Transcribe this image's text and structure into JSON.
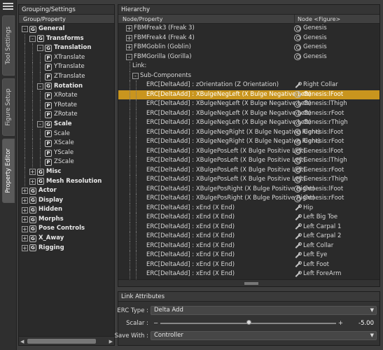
{
  "tabs": {
    "tool_settings": "Tool Settings",
    "figure_setup": "Figure Setup",
    "property_editor": "Property Editor"
  },
  "left_panel": {
    "title": "Grouping/Settings",
    "column": "Group/Property",
    "tree": [
      {
        "level": 0,
        "kind": "group",
        "toggle": "-",
        "label": "General",
        "bold": true
      },
      {
        "level": 1,
        "kind": "group",
        "toggle": "-",
        "label": "Transforms",
        "bold": true
      },
      {
        "level": 2,
        "kind": "group",
        "toggle": "-",
        "label": "Translation",
        "bold": true
      },
      {
        "level": 3,
        "kind": "prop",
        "label": "XTranslate"
      },
      {
        "level": 3,
        "kind": "prop",
        "label": "YTranslate"
      },
      {
        "level": 3,
        "kind": "prop",
        "label": "ZTranslate"
      },
      {
        "level": 2,
        "kind": "group",
        "toggle": "-",
        "label": "Rotation",
        "bold": true
      },
      {
        "level": 3,
        "kind": "prop",
        "label": "XRotate"
      },
      {
        "level": 3,
        "kind": "prop",
        "label": "YRotate"
      },
      {
        "level": 3,
        "kind": "prop",
        "label": "ZRotate"
      },
      {
        "level": 2,
        "kind": "group",
        "toggle": "-",
        "label": "Scale",
        "bold": true
      },
      {
        "level": 3,
        "kind": "prop",
        "label": "Scale"
      },
      {
        "level": 3,
        "kind": "prop",
        "label": "XScale"
      },
      {
        "level": 3,
        "kind": "prop",
        "label": "YScale"
      },
      {
        "level": 3,
        "kind": "prop",
        "label": "ZScale"
      },
      {
        "level": 1,
        "kind": "group",
        "toggle": "+",
        "label": "Misc",
        "bold": true
      },
      {
        "level": 1,
        "kind": "group",
        "toggle": "+",
        "label": "Mesh Resolution",
        "bold": true
      },
      {
        "level": 0,
        "kind": "group",
        "toggle": "+",
        "label": "Actor",
        "bold": true
      },
      {
        "level": 0,
        "kind": "group",
        "toggle": "+",
        "label": "Display",
        "bold": true
      },
      {
        "level": 0,
        "kind": "group",
        "toggle": "+",
        "label": "Hidden",
        "bold": true
      },
      {
        "level": 0,
        "kind": "group",
        "toggle": "+",
        "label": "Morphs",
        "bold": true
      },
      {
        "level": 0,
        "kind": "group",
        "toggle": "+",
        "label": "Pose Controls",
        "bold": true
      },
      {
        "level": 0,
        "kind": "group",
        "toggle": "+",
        "label": "X_Away",
        "bold": true
      },
      {
        "level": 0,
        "kind": "group",
        "toggle": "+",
        "label": "Rigging",
        "bold": true
      }
    ]
  },
  "hierarchy": {
    "title": "Hierarchy",
    "col_property": "Node/Property",
    "col_node": "Node <Figure>",
    "rows": [
      {
        "level": 1,
        "toggle": "+",
        "prop": "FBMFreak3 (Freak 3)",
        "node": "Genesis",
        "icon": "figure"
      },
      {
        "level": 1,
        "toggle": "+",
        "prop": "FBMFreak4 (Freak 4)",
        "node": "Genesis",
        "icon": "figure"
      },
      {
        "level": 1,
        "toggle": "+",
        "prop": "FBMGoblin (Goblin)",
        "node": "Genesis",
        "icon": "figure"
      },
      {
        "level": 1,
        "toggle": "-",
        "prop": "FBMGorilla (Gorilla)",
        "node": "Genesis",
        "icon": "figure"
      },
      {
        "level": 2,
        "toggle": "",
        "prop": "Link:",
        "node": "",
        "icon": ""
      },
      {
        "level": 2,
        "toggle": "-",
        "prop": "Sub-Components",
        "node": "",
        "icon": ""
      },
      {
        "level": 3,
        "toggle": "",
        "prop": "ERC[DeltaAdd] : zOrientation (Z Orientation)",
        "node": "Right Collar",
        "icon": "bone"
      },
      {
        "level": 3,
        "toggle": "",
        "prop": "ERC[DeltaAdd] : XBulgeNegLeft (X Bulge Negative Left)",
        "node": "Genesis:lFoot",
        "icon": "figure",
        "selected": true
      },
      {
        "level": 3,
        "toggle": "",
        "prop": "ERC[DeltaAdd] : XBulgeNegLeft (X Bulge Negative Left)",
        "node": "Genesis:lThigh",
        "icon": "figure"
      },
      {
        "level": 3,
        "toggle": "",
        "prop": "ERC[DeltaAdd] : XBulgeNegLeft (X Bulge Negative Left)",
        "node": "Genesis:rFoot",
        "icon": "figure"
      },
      {
        "level": 3,
        "toggle": "",
        "prop": "ERC[DeltaAdd] : XBulgeNegLeft (X Bulge Negative Left)",
        "node": "Genesis:rThigh",
        "icon": "figure"
      },
      {
        "level": 3,
        "toggle": "",
        "prop": "ERC[DeltaAdd] : XBulgeNegRight (X Bulge Negative Right)",
        "node": "Genesis:lFoot",
        "icon": "figure"
      },
      {
        "level": 3,
        "toggle": "",
        "prop": "ERC[DeltaAdd] : XBulgeNegRight (X Bulge Negative Right)",
        "node": "Genesis:rFoot",
        "icon": "figure"
      },
      {
        "level": 3,
        "toggle": "",
        "prop": "ERC[DeltaAdd] : XBulgePosLeft (X Bulge Positive Left)",
        "node": "Genesis:lFoot",
        "icon": "figure"
      },
      {
        "level": 3,
        "toggle": "",
        "prop": "ERC[DeltaAdd] : XBulgePosLeft (X Bulge Positive Left)",
        "node": "Genesis:lThigh",
        "icon": "figure"
      },
      {
        "level": 3,
        "toggle": "",
        "prop": "ERC[DeltaAdd] : XBulgePosLeft (X Bulge Positive Left)",
        "node": "Genesis:rFoot",
        "icon": "figure"
      },
      {
        "level": 3,
        "toggle": "",
        "prop": "ERC[DeltaAdd] : XBulgePosLeft (X Bulge Positive Left)",
        "node": "Genesis:rThigh",
        "icon": "figure"
      },
      {
        "level": 3,
        "toggle": "",
        "prop": "ERC[DeltaAdd] : XBulgePosRight (X Bulge Positive Right)",
        "node": "Genesis:lFoot",
        "icon": "figure"
      },
      {
        "level": 3,
        "toggle": "",
        "prop": "ERC[DeltaAdd] : XBulgePosRight (X Bulge Positive Right)",
        "node": "Genesis:rFoot",
        "icon": "figure"
      },
      {
        "level": 3,
        "toggle": "",
        "prop": "ERC[DeltaAdd] : xEnd (X End)",
        "node": "Hip",
        "icon": "bone"
      },
      {
        "level": 3,
        "toggle": "",
        "prop": "ERC[DeltaAdd] : xEnd (X End)",
        "node": "Left Big Toe",
        "icon": "bone"
      },
      {
        "level": 3,
        "toggle": "",
        "prop": "ERC[DeltaAdd] : xEnd (X End)",
        "node": "Left Carpal 1",
        "icon": "bone"
      },
      {
        "level": 3,
        "toggle": "",
        "prop": "ERC[DeltaAdd] : xEnd (X End)",
        "node": "Left Carpal 2",
        "icon": "bone"
      },
      {
        "level": 3,
        "toggle": "",
        "prop": "ERC[DeltaAdd] : xEnd (X End)",
        "node": "Left Collar",
        "icon": "bone"
      },
      {
        "level": 3,
        "toggle": "",
        "prop": "ERC[DeltaAdd] : xEnd (X End)",
        "node": "Left Eye",
        "icon": "bone"
      },
      {
        "level": 3,
        "toggle": "",
        "prop": "ERC[DeltaAdd] : xEnd (X End)",
        "node": "Left Foot",
        "icon": "bone"
      },
      {
        "level": 3,
        "toggle": "",
        "prop": "ERC[DeltaAdd] : xEnd (X End)",
        "node": "Left ForeArm",
        "icon": "bone"
      }
    ]
  },
  "link_attributes": {
    "title": "Link Attributes",
    "erc_type_label": "ERC Type :",
    "erc_type_value": "Delta Add",
    "scalar_label": "Scalar :",
    "scalar_value": "-5.00",
    "scalar_position": 0.5,
    "save_with_label": "Save With :",
    "save_with_value": "Controller"
  },
  "colors": {
    "selection": "#c9951e",
    "panel_bg": "#2a2a2a"
  }
}
